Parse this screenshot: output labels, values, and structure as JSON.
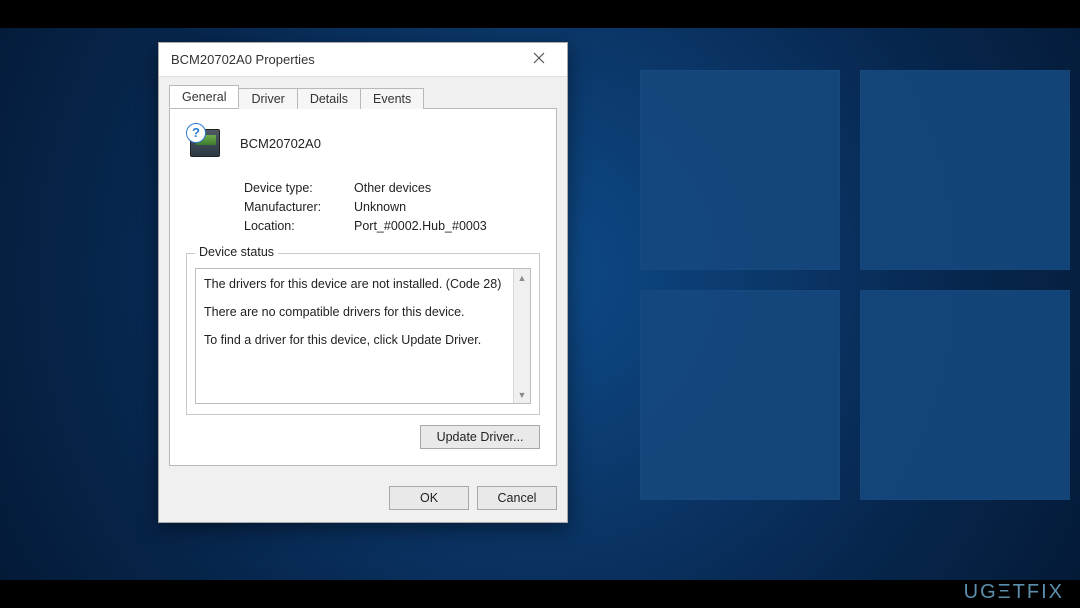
{
  "watermark": "UGΞTFIX",
  "dialog": {
    "title": "BCM20702A0 Properties",
    "tabs": {
      "general": "General",
      "driver": "Driver",
      "details": "Details",
      "events": "Events"
    },
    "device": {
      "name": "BCM20702A0",
      "type_label": "Device type:",
      "type_value": "Other devices",
      "manufacturer_label": "Manufacturer:",
      "manufacturer_value": "Unknown",
      "location_label": "Location:",
      "location_value": "Port_#0002.Hub_#0003"
    },
    "status": {
      "legend": "Device status",
      "line1": "The drivers for this device are not installed. (Code 28)",
      "line2": "There are no compatible drivers for this device.",
      "line3": "To find a driver for this device, click Update Driver."
    },
    "buttons": {
      "update": "Update Driver...",
      "ok": "OK",
      "cancel": "Cancel"
    }
  }
}
